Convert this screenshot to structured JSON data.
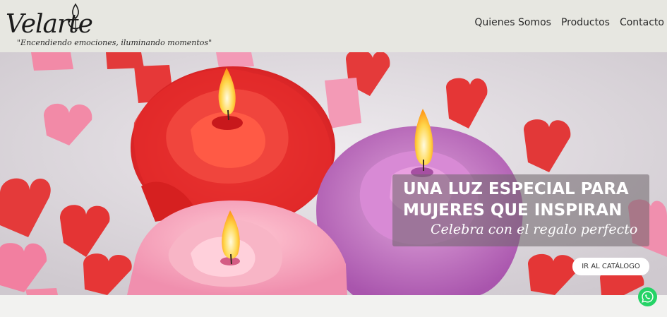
{
  "header": {
    "brand_name": "Velarte",
    "tagline": "\"Encendiendo emociones, iluminando momentos\"",
    "nav": [
      {
        "label": "Quienes Somos"
      },
      {
        "label": "Productos"
      },
      {
        "label": "Contacto"
      }
    ]
  },
  "hero": {
    "headline": "UNA LUZ ESPECIAL PARA\nMUJERES QUE INSPIRAN",
    "subtitle": "Celebra con el regalo perfecto",
    "cta_label": "IR AL CATÁLOGO"
  },
  "floating": {
    "whatsapp_icon": "whatsapp-icon"
  },
  "colors": {
    "header_bg": "#e7e7e1",
    "whatsapp": "#25d366",
    "candle_red": "#e02d2d",
    "candle_pink": "#f4a9bd",
    "candle_purple": "#c785c6"
  }
}
